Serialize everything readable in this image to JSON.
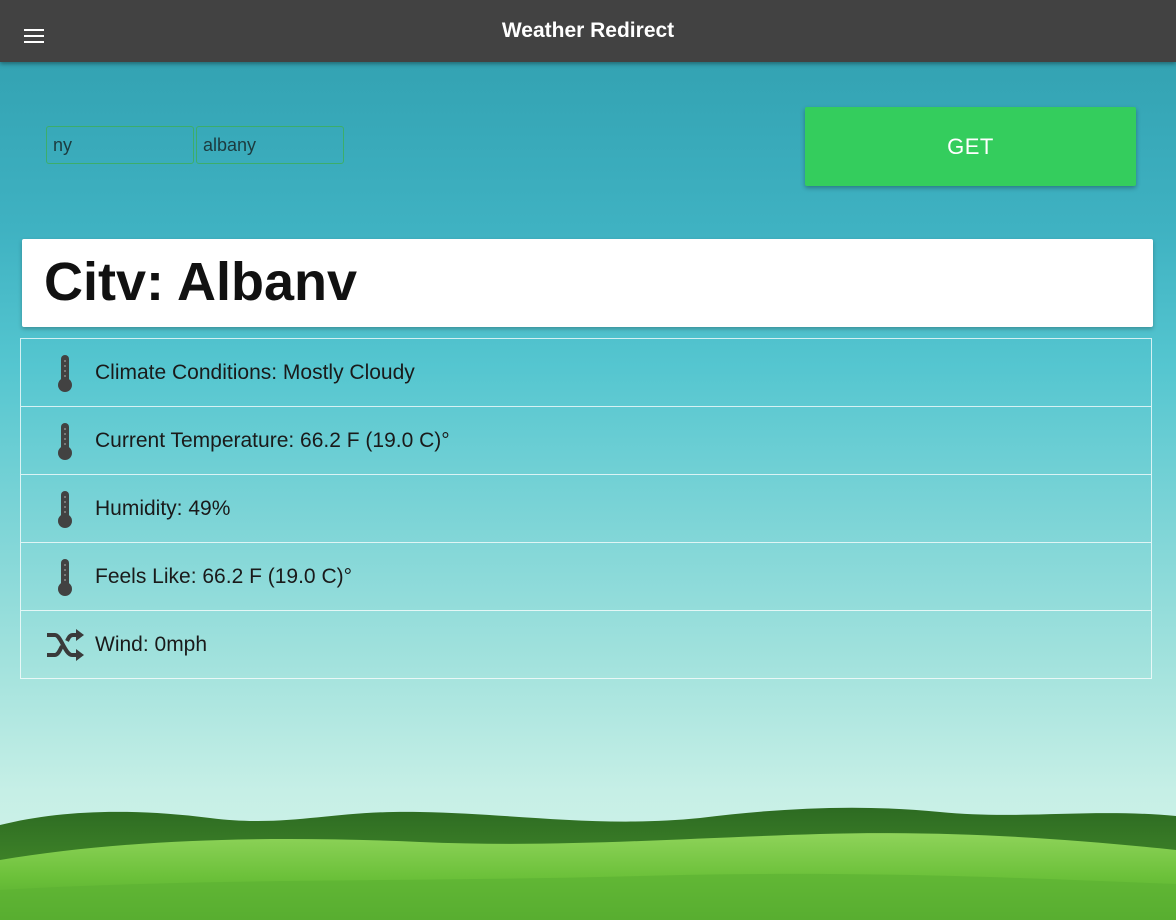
{
  "header": {
    "title": "Weather Redirect",
    "menu_icon": "hamburger-menu-icon"
  },
  "search": {
    "state_value": "ny",
    "city_value": "albany",
    "button_label": "GET",
    "button_color": "#34cd5d"
  },
  "city_card": {
    "heading": "Citv: Albanv"
  },
  "details": [
    {
      "icon": "thermometer-icon",
      "text": "Climate Conditions: Mostly Cloudy"
    },
    {
      "icon": "thermometer-icon",
      "text": "Current Temperature: 66.2 F (19.0 C)°"
    },
    {
      "icon": "thermometer-icon",
      "text": "Humidity: 49%"
    },
    {
      "icon": "thermometer-icon",
      "text": "Feels Like: 66.2 F (19.0 C)°"
    },
    {
      "icon": "shuffle-icon",
      "text": "Wind: 0mph"
    }
  ],
  "colors": {
    "appbar": "#424242",
    "accent": "#34cd5d"
  }
}
